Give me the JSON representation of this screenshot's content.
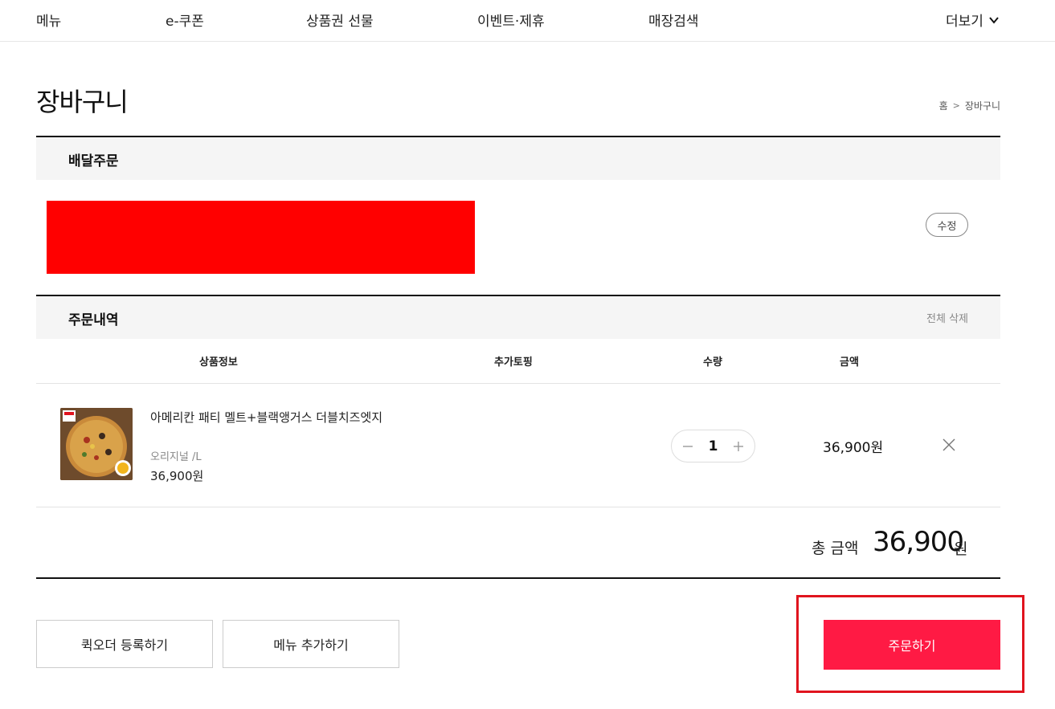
{
  "nav": {
    "items": [
      "메뉴",
      "e-쿠폰",
      "상품권 선물",
      "이벤트·제휴",
      "매장검색"
    ],
    "more_label": "더보기"
  },
  "page": {
    "title": "장바구니",
    "breadcrumb": [
      "홈",
      "장바구니"
    ]
  },
  "delivery": {
    "section_label": "배달주문",
    "edit_label": "수정"
  },
  "order": {
    "section_label": "주문내역",
    "clear_all_label": "전체 삭제",
    "columns": [
      "상품정보",
      "추가토핑",
      "수량",
      "금액"
    ],
    "items": [
      {
        "name": "아메리칸 패티 멜트+블랙앵거스 더블치즈엣지",
        "option": "오리지널 /L",
        "price": "36,900원",
        "quantity": "1",
        "amount": "36,900원"
      }
    ]
  },
  "total": {
    "label": "총 금액",
    "value": "36,900",
    "unit": "원"
  },
  "buttons": {
    "quick_order": "퀵오더 등록하기",
    "add_menu": "메뉴 추가하기",
    "order": "주문하기"
  },
  "colors": {
    "accent": "#ff1a44",
    "highlight": "#e0141e",
    "redaction": "#ff0000"
  }
}
